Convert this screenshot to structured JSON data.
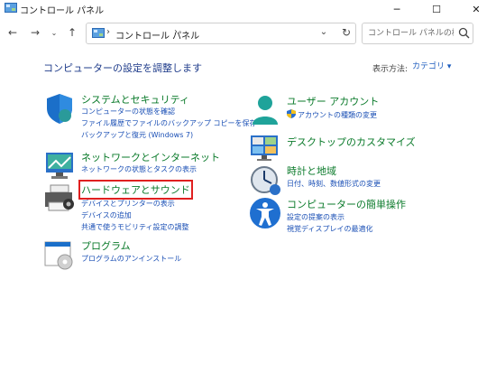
{
  "window": {
    "title": "コントロール パネル",
    "min_glyph": "─",
    "max_glyph": "☐",
    "close_glyph": "✕"
  },
  "nav": {
    "back_glyph": "←",
    "forward_glyph": "→",
    "recent_glyph": "⌄",
    "up_glyph": "↑",
    "address_text": "コントロール パネル",
    "address_sep": "›",
    "dropdown_glyph": "⌄",
    "refresh_glyph": "↻",
    "search_placeholder": "コントロール パネルの検索"
  },
  "header": {
    "title": "コンピューターの設定を調整します",
    "view_by_label": "表示方法:",
    "view_by_value": "カテゴリ ▾"
  },
  "categories_left": [
    {
      "id": "system",
      "title": "システムとセキュリティ",
      "links": [
        "コンピューターの状態を確認",
        "ファイル履歴でファイルのバックアップ コピーを保存",
        "バックアップと復元 (Windows 7)"
      ]
    },
    {
      "id": "network",
      "title": "ネットワークとインターネット",
      "links": [
        "ネットワークの状態とタスクの表示"
      ]
    },
    {
      "id": "hardware",
      "title": "ハードウェアとサウンド",
      "links": [
        "デバイスとプリンターの表示",
        "デバイスの追加",
        "共通で使うモビリティ設定の調整"
      ]
    },
    {
      "id": "programs",
      "title": "プログラム",
      "links": [
        "プログラムのアンインストール"
      ]
    }
  ],
  "categories_right": [
    {
      "id": "user",
      "title": "ユーザー アカウント",
      "links": [
        "アカウントの種類の変更"
      ]
    },
    {
      "id": "desktop",
      "title": "デスクトップのカスタマイズ",
      "links": []
    },
    {
      "id": "clock",
      "title": "時計と地域",
      "links": [
        "日付、時刻、数値形式の変更"
      ]
    },
    {
      "id": "ease",
      "title": "コンピューターの簡単操作",
      "links": [
        "設定の提案の表示",
        "視覚ディスプレイの最適化"
      ]
    }
  ],
  "colors": {
    "category_title": "#0a7a2a",
    "link": "#1a4fb5",
    "page_title": "#1e3b8a",
    "highlight": "#e02020"
  }
}
